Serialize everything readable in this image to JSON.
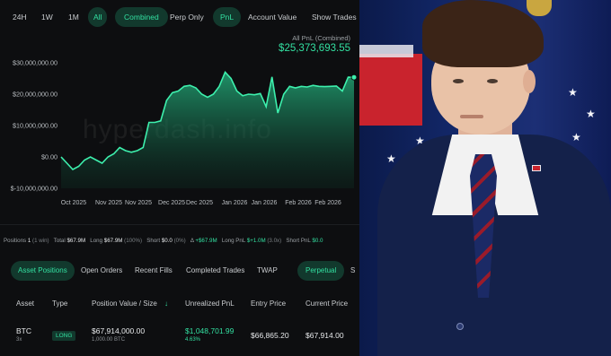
{
  "toolbar": {
    "range_buttons": [
      "24H",
      "1W",
      "1M",
      "All"
    ],
    "mode_buttons": [
      "Combined",
      "Perp Only"
    ],
    "metric_buttons": [
      "PnL",
      "Account Value"
    ],
    "show_trades": "Show Trades"
  },
  "pnl_header": {
    "label": "All PnL (Combined)",
    "value": "$25,373,693.55"
  },
  "watermark": "hyperdash.info",
  "chart_data": {
    "type": "area",
    "ylabel": "",
    "xlabel": "",
    "y_ticks": [
      "$30,000,000.00",
      "$20,000,000.00",
      "$10,000,000.00",
      "$0.00",
      "$-10,000,000.00"
    ],
    "ylim": [
      -10000000,
      30000000
    ],
    "x_ticks": [
      "Oct 2025",
      "Nov 2025",
      "Nov 2025",
      "Dec 2025",
      "Dec 2025",
      "Jan 2026",
      "Jan 2026",
      "Feb 2026",
      "Feb 2026"
    ],
    "series": [
      {
        "x": [
          0,
          2,
          4,
          6,
          8,
          10,
          12,
          14,
          16,
          18,
          20,
          22,
          24,
          26,
          28,
          30,
          32,
          34,
          36,
          38,
          40,
          42,
          44,
          46,
          48,
          50,
          52,
          54,
          56,
          58,
          60,
          62,
          64,
          66,
          68,
          70,
          72,
          74,
          76,
          78,
          80,
          82,
          84,
          86,
          88,
          90,
          92,
          94,
          96,
          98,
          100
        ],
        "values": [
          0,
          -2000000,
          -4000000,
          -3000000,
          -1000000,
          0,
          -1000000,
          -2000000,
          0,
          1000000,
          3000000,
          2000000,
          1500000,
          2000000,
          3000000,
          11000000,
          11000000,
          11500000,
          18000000,
          20500000,
          21000000,
          22500000,
          22800000,
          22000000,
          20000000,
          19000000,
          20000000,
          22500000,
          27000000,
          25000000,
          21000000,
          19500000,
          20000000,
          19800000,
          20200000,
          16000000,
          25500000,
          14000000,
          20000000,
          22500000,
          22000000,
          22500000,
          22300000,
          22800000,
          22500000,
          22400000,
          22500000,
          22600000,
          21000000,
          25400000,
          25373693
        ]
      }
    ]
  },
  "stats": {
    "positions_label": "Positions",
    "positions_value": "1",
    "positions_sub": "(1 win)",
    "total_label": "Total",
    "total_value": "$67.9M",
    "long_label": "Long",
    "long_value": "$67.9M",
    "long_pct": "(100%)",
    "short_label": "Short",
    "short_value": "$0.0",
    "short_pct": "(0%)",
    "delta_label": "Δ",
    "delta_value": "+$67.9M",
    "long_pnl_label": "Long PnL",
    "long_pnl_value": "$+1.0M",
    "long_pnl_sub": "(3.0x)",
    "short_pnl_label": "Short PnL",
    "short_pnl_value": "$0.0"
  },
  "tabs": [
    "Asset Positions",
    "Open Orders",
    "Recent Fills",
    "Completed Trades",
    "TWAP"
  ],
  "tab_right": [
    "Perpetual",
    "S"
  ],
  "table": {
    "headers": [
      "Asset",
      "Type",
      "Position Value / Size",
      "Unrealized PnL",
      "Entry Price",
      "Current Price"
    ],
    "sort_icon": "arrow-down-icon",
    "row": {
      "asset": "BTC",
      "leverage": "3x",
      "type": "LONG",
      "position_value": "$67,914,000.00",
      "size": "1,000.00 BTC",
      "unrealized_pnl": "$1,048,701.99",
      "pnl_pct": "4.63%",
      "entry_price": "$66,865.20",
      "current_price": "$67,914.00"
    }
  },
  "colors": {
    "accent": "#33e0a1",
    "accent_bg": "#12392d",
    "panel_bg": "#0d0e10"
  }
}
